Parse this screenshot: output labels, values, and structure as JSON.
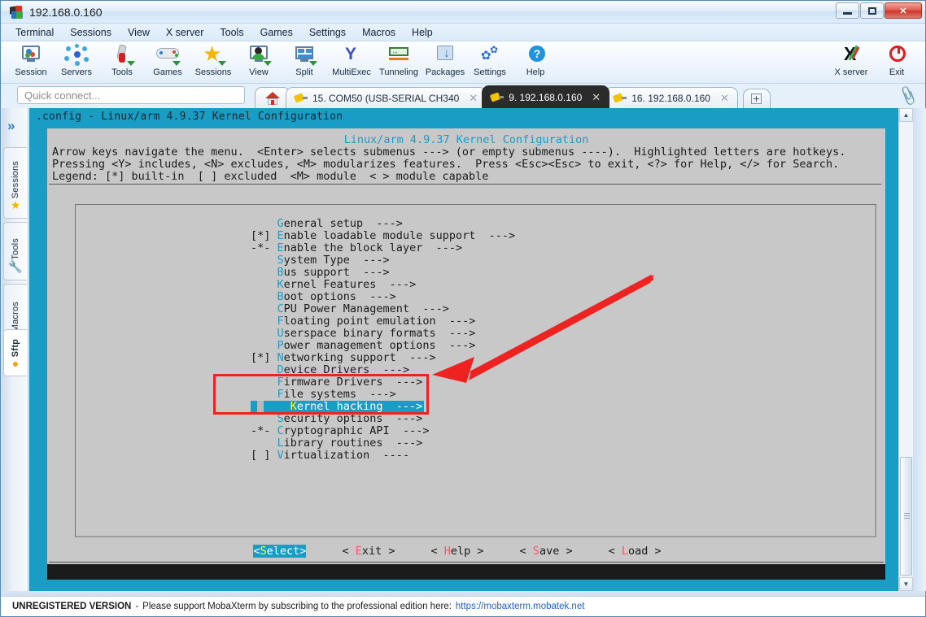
{
  "window": {
    "title": "192.168.0.160",
    "app_icon": "mobaxterm-icon",
    "minimize_label": "Minimize",
    "maximize_label": "Maximize",
    "close_label": "✕"
  },
  "menubar": {
    "items": [
      "Terminal",
      "Sessions",
      "View",
      "X server",
      "Tools",
      "Games",
      "Settings",
      "Macros",
      "Help"
    ]
  },
  "toolbar": {
    "buttons": [
      {
        "label": "Session",
        "icon": "session-monitor-icon"
      },
      {
        "label": "Servers",
        "icon": "servers-network-icon"
      },
      {
        "label": "Tools",
        "icon": "tools-knife-icon"
      },
      {
        "label": "Games",
        "icon": "games-gamepad-icon"
      },
      {
        "label": "Sessions",
        "icon": "sessions-star-icon"
      },
      {
        "label": "View",
        "icon": "view-monitor-icon"
      },
      {
        "label": "Split",
        "icon": "split-panes-icon"
      },
      {
        "label": "MultiExec",
        "icon": "multiexec-fork-icon"
      },
      {
        "label": "Tunneling",
        "icon": "tunneling-arrows-icon"
      },
      {
        "label": "Packages",
        "icon": "packages-download-icon"
      },
      {
        "label": "Settings",
        "icon": "settings-gear-icon"
      },
      {
        "label": "Help",
        "icon": "help-question-icon"
      }
    ],
    "right_buttons": [
      {
        "label": "X server",
        "icon": "x-server-icon"
      },
      {
        "label": "Exit",
        "icon": "exit-power-icon"
      }
    ]
  },
  "quick_connect": {
    "placeholder": "Quick connect...",
    "value": ""
  },
  "tabs": {
    "home_icon": "home-icon",
    "items": [
      {
        "label": "15. COM50  (USB-SERIAL CH340",
        "icon": "plug-icon",
        "active": false,
        "close": "✕"
      },
      {
        "label": "9. 192.168.0.160",
        "icon": "plug-icon",
        "active": true,
        "close": "✕"
      },
      {
        "label": "16. 192.168.0.160",
        "icon": "plug-icon",
        "active": false,
        "close": "✕"
      }
    ],
    "new_tab_label": "+",
    "attach_icon": "paperclip-icon"
  },
  "sidebar": {
    "expand_icon": "chevrons-right-icon",
    "items": [
      {
        "label": "Sessions",
        "icon": "star-icon",
        "active": false
      },
      {
        "label": "Tools",
        "icon": "knife-icon",
        "active": false
      },
      {
        "label": "Macros",
        "icon": "paper-plane-icon",
        "active": false
      },
      {
        "label": "Sftp",
        "icon": "globe-icon",
        "active": true
      }
    ]
  },
  "terminal": {
    "window_title": ".config - Linux/arm 4.9.37 Kernel Configuration",
    "dialog_title": "Linux/arm 4.9.37 Kernel Configuration",
    "help_lines": [
      "Arrow keys navigate the menu.  <Enter> selects submenus ---> (or empty submenus ----).  Highlighted letters are hotkeys.",
      "Pressing <Y> includes, <N> excludes, <M> modularizes features.  Press <Esc><Esc> to exit, <?> for Help, </> for Search.",
      "Legend: [*] built-in  [ ] excluded  <M> module  < > module capable"
    ],
    "menu_items": [
      {
        "prefix": "    ",
        "hotkey": "G",
        "rest": "eneral setup  --->",
        "selected": false
      },
      {
        "prefix": "[*] ",
        "hotkey": "E",
        "rest": "nable loadable module support  --->",
        "selected": false
      },
      {
        "prefix": "-*- ",
        "hotkey": "E",
        "rest": "nable the block layer  --->",
        "selected": false
      },
      {
        "prefix": "    ",
        "hotkey": "S",
        "rest": "ystem Type  --->",
        "selected": false
      },
      {
        "prefix": "    ",
        "hotkey": "B",
        "rest": "us support  --->",
        "selected": false
      },
      {
        "prefix": "    ",
        "hotkey": "K",
        "rest": "ernel Features  --->",
        "selected": false
      },
      {
        "prefix": "    ",
        "hotkey": "B",
        "rest": "oot options  --->",
        "selected": false
      },
      {
        "prefix": "    ",
        "hotkey": "C",
        "rest": "PU Power Management  --->",
        "selected": false
      },
      {
        "prefix": "    ",
        "hotkey": "F",
        "rest": "loating point emulation  --->",
        "selected": false
      },
      {
        "prefix": "    ",
        "hotkey": "U",
        "rest": "serspace binary formats  --->",
        "selected": false
      },
      {
        "prefix": "    ",
        "hotkey": "P",
        "rest": "ower management options  --->",
        "selected": false
      },
      {
        "prefix": "[*] ",
        "hotkey": "N",
        "rest": "etworking support  --->",
        "selected": false
      },
      {
        "prefix": "    ",
        "hotkey": "D",
        "rest": "evice Drivers  --->",
        "selected": false
      },
      {
        "prefix": "    ",
        "hotkey": "F",
        "rest": "irmware Drivers  --->",
        "selected": false
      },
      {
        "prefix": "    ",
        "hotkey": "F",
        "rest": "ile systems  --->",
        "selected": false
      },
      {
        "prefix": "    ",
        "hotkey": "K",
        "rest": "ernel hacking  --->",
        "selected": true
      },
      {
        "prefix": "    ",
        "hotkey": "S",
        "rest": "ecurity options  --->",
        "selected": false
      },
      {
        "prefix": "-*- ",
        "hotkey": "C",
        "rest": "ryptographic API  --->",
        "selected": false
      },
      {
        "prefix": "    ",
        "hotkey": "L",
        "rest": "ibrary routines  --->",
        "selected": false
      },
      {
        "prefix": "[ ] ",
        "hotkey": "V",
        "rest": "irtualization  ----",
        "selected": false
      }
    ],
    "buttons": [
      {
        "open": "<",
        "hotkey": "S",
        "rest": "elect>",
        "selected": true
      },
      {
        "open": "< ",
        "hotkey": "E",
        "rest": "xit >",
        "selected": false
      },
      {
        "open": "< ",
        "hotkey": "H",
        "rest": "elp >",
        "selected": false
      },
      {
        "open": "< ",
        "hotkey": "S",
        "rest": "ave >",
        "selected": false
      },
      {
        "open": "< ",
        "hotkey": "L",
        "rest": "oad >",
        "selected": false
      }
    ],
    "colors": {
      "background": "#c8c8c8",
      "accent": "#1a9dc4",
      "hotkey": "#1a9dc4",
      "selected_hotkey": "#ffff2e",
      "button_hotkey": "#f2596b"
    }
  },
  "annotations": {
    "highlight_box_color": "#ef2222",
    "arrow_color": "#ef2222"
  },
  "status": {
    "unregistered": "UNREGISTERED VERSION",
    "dash": "-",
    "message": "Please support MobaXterm by subscribing to the professional edition here:",
    "link": "https://mobaxterm.mobatek.net"
  }
}
